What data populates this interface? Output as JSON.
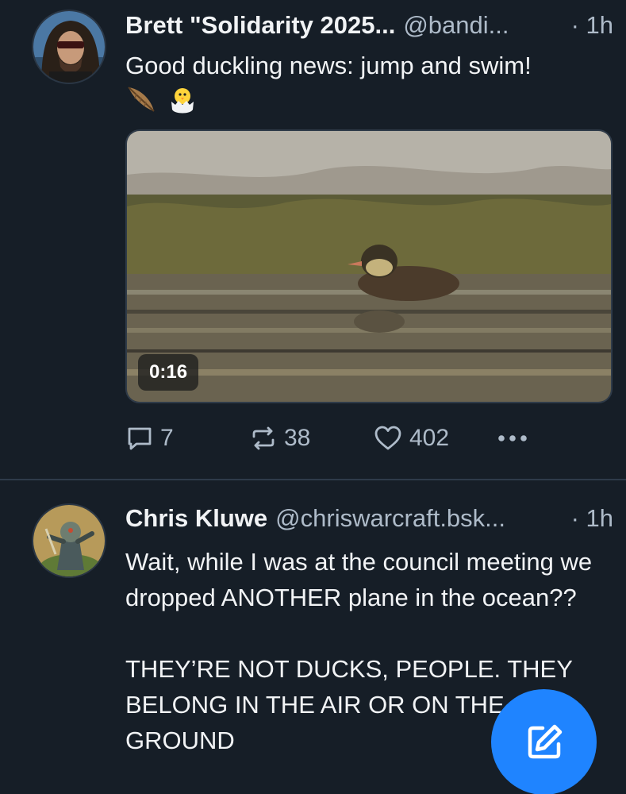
{
  "posts": [
    {
      "author_name": "Brett \"Solidarity 2025...",
      "author_handle": "@bandi...",
      "time": "· 1h",
      "text": "Good duckling news: jump and swim!",
      "emojis": [
        "feather-emoji",
        "hatching-chick-emoji"
      ],
      "video": {
        "duration": "0:16"
      },
      "stats": {
        "replies": "7",
        "reposts": "38",
        "likes": "402"
      }
    },
    {
      "author_name": "Chris Kluwe",
      "author_handle": "@chriswarcraft.bsk...",
      "time": "· 1h",
      "text": "Wait, while I was at the council meeting we dropped ANOTHER plane in the ocean??\n\nTHEY’RE NOT DUCKS, PEOPLE. THEY BELONG IN THE AIR OR ON THE GROUND"
    }
  ],
  "compose": {
    "icon": "compose-pencil-icon"
  },
  "colors": {
    "background": "#161e27",
    "text": "#f1f3f5",
    "muted": "#aebbc9",
    "accent": "#1f84ff",
    "divider": "#2e3b4a"
  }
}
